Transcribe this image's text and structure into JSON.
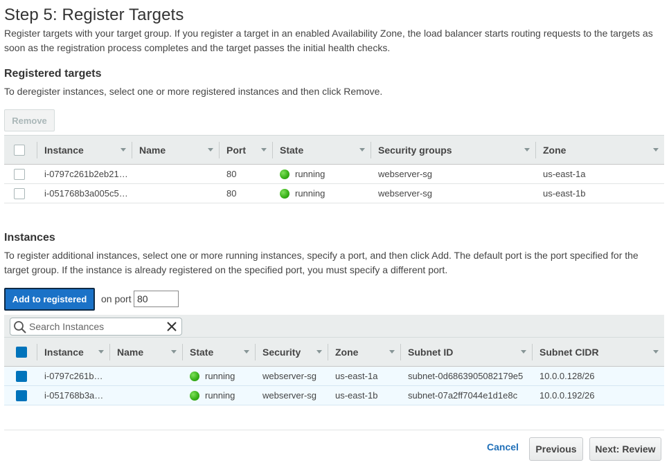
{
  "page": {
    "title": "Step 5: Register Targets",
    "intro": "Register targets with your target group. If you register a target in an enabled Availability Zone, the load balancer starts routing requests to the targets as soon as the registration process completes and the target passes the initial health checks."
  },
  "registered": {
    "title": "Registered targets",
    "description": "To deregister instances, select one or more registered instances and then click Remove.",
    "remove_label": "Remove",
    "columns": [
      "Instance",
      "Name",
      "Port",
      "State",
      "Security groups",
      "Zone"
    ],
    "rows": [
      {
        "instance": "i-0797c261b2eb21…",
        "name": "",
        "port": "80",
        "state": "running",
        "security": "webserver-sg",
        "zone": "us-east-1a"
      },
      {
        "instance": "i-051768b3a005c5…",
        "name": "",
        "port": "80",
        "state": "running",
        "security": "webserver-sg",
        "zone": "us-east-1b"
      }
    ]
  },
  "instances": {
    "title": "Instances",
    "description": "To register additional instances, select one or more running instances, specify a port, and then click Add. The default port is the port specified for the target group. If the instance is already registered on the specified port, you must specify a different port.",
    "add_label": "Add to registered",
    "port_label": "on port",
    "port_value": "80",
    "search_placeholder": "Search Instances",
    "columns": [
      "Instance",
      "Name",
      "State",
      "Security",
      "Zone",
      "Subnet ID",
      "Subnet CIDR"
    ],
    "rows": [
      {
        "instance": "i-0797c261b…",
        "name": "",
        "state": "running",
        "security": "webserver-sg",
        "zone": "us-east-1a",
        "subnet_id": "subnet-0d6863905082179e5",
        "subnet_cidr": "10.0.0.128/26"
      },
      {
        "instance": "i-051768b3a…",
        "name": "",
        "state": "running",
        "security": "webserver-sg",
        "zone": "us-east-1b",
        "subnet_id": "subnet-07a2ff7044e1d1e8c",
        "subnet_cidr": "10.0.0.192/26"
      }
    ]
  },
  "footer": {
    "cancel_label": "Cancel",
    "previous_label": "Previous",
    "next_label": "Next: Review"
  },
  "colors": {
    "primary": "#1b72c7",
    "link": "#1f6fb8",
    "status_running": "#3ab21a",
    "header_bg": "#eaeded",
    "selected_row": "#f1faff"
  }
}
